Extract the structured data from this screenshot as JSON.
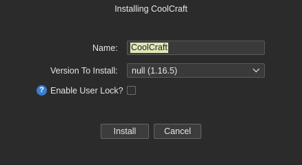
{
  "dialog": {
    "title": "Installing CoolCraft"
  },
  "form": {
    "name_label": "Name:",
    "name_value": "CoolCraft",
    "version_label": "Version To Install:",
    "version_value": "null (1.16.5)",
    "user_lock_label": "Enable User Lock?",
    "user_lock_checked": false,
    "help_icon_glyph": "?"
  },
  "buttons": {
    "install": "Install",
    "cancel": "Cancel"
  },
  "icons": {
    "help": "help-icon",
    "dropdown": "chevron-down-icon"
  },
  "colors": {
    "background": "#2b2b2b",
    "selection_highlight": "#dfe8b6",
    "help_icon": "#3a7fd0"
  }
}
